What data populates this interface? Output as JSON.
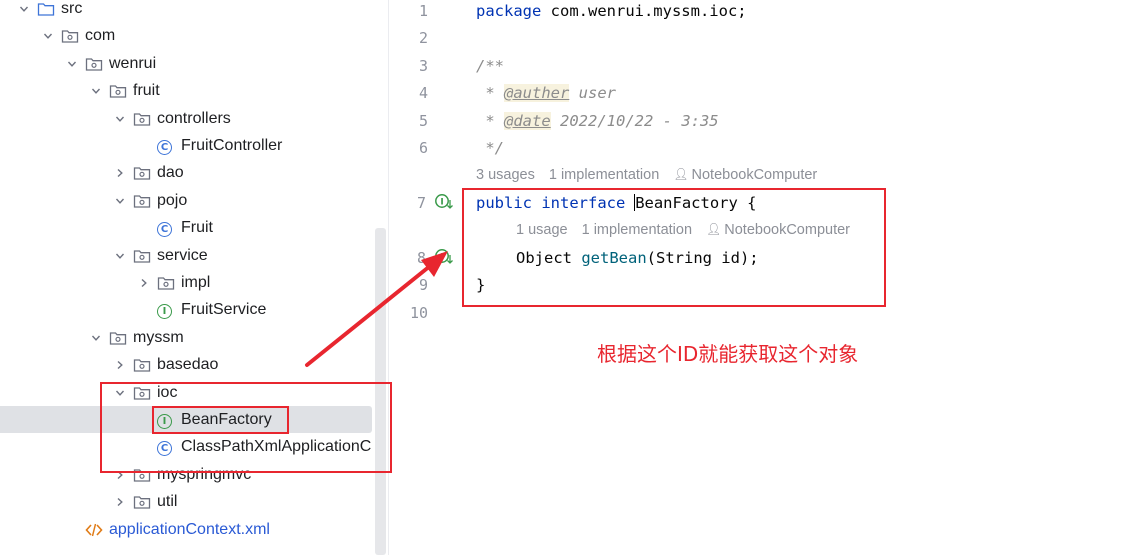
{
  "tree": {
    "items": [
      {
        "label": "src",
        "kind": "folder-src",
        "chevron": "down"
      },
      {
        "label": "com",
        "kind": "package",
        "chevron": "down"
      },
      {
        "label": "wenrui",
        "kind": "package",
        "chevron": "down"
      },
      {
        "label": "fruit",
        "kind": "package",
        "chevron": "down"
      },
      {
        "label": "controllers",
        "kind": "package",
        "chevron": "down"
      },
      {
        "label": "FruitController",
        "kind": "class"
      },
      {
        "label": "dao",
        "kind": "package",
        "chevron": "right"
      },
      {
        "label": "pojo",
        "kind": "package",
        "chevron": "down"
      },
      {
        "label": "Fruit",
        "kind": "class"
      },
      {
        "label": "service",
        "kind": "package",
        "chevron": "down"
      },
      {
        "label": "impl",
        "kind": "package",
        "chevron": "right"
      },
      {
        "label": "FruitService",
        "kind": "interface"
      },
      {
        "label": "myssm",
        "kind": "package",
        "chevron": "down"
      },
      {
        "label": "basedao",
        "kind": "package",
        "chevron": "right"
      },
      {
        "label": "ioc",
        "kind": "package",
        "chevron": "down"
      },
      {
        "label": "BeanFactory",
        "kind": "interface",
        "selected": true
      },
      {
        "label": "ClassPathXmlApplicationC",
        "kind": "class"
      },
      {
        "label": "myspringmvc",
        "kind": "package",
        "chevron": "right"
      },
      {
        "label": "util",
        "kind": "package",
        "chevron": "right"
      },
      {
        "label": "applicationContext.xml",
        "kind": "xml"
      }
    ]
  },
  "editor": {
    "line_numbers": [
      "1",
      "2",
      "3",
      "4",
      "5",
      "6",
      "7",
      "8",
      "9",
      "10"
    ],
    "line1": {
      "kw": "package",
      "rest": " com.wenrui.myssm.ioc;"
    },
    "line3": "/**",
    "line4": {
      "star": " * ",
      "tag": "@auther",
      "text": " user"
    },
    "line5": {
      "star": " * ",
      "tag": "@date",
      "text": " 2022/10/22 - 3:35"
    },
    "line6": " */",
    "hint_interface": {
      "usages": "3 usages",
      "impl": "1 implementation",
      "author": "NotebookComputer"
    },
    "line7": {
      "kw1": "public",
      "kw2": "interface",
      "name": "BeanFactory",
      "brace": " {"
    },
    "hint_method": {
      "usages": "1 usage",
      "impl": "1 implementation",
      "author": "NotebookComputer"
    },
    "line8": {
      "type": "Object ",
      "fn": "getBean",
      "args": "(String id);"
    },
    "line9": "}"
  },
  "annotation": {
    "note": "根据这个ID就能获取这个对象",
    "color": "#e8262f"
  },
  "colors": {
    "keyword": "#0033b3",
    "comment": "#8c8c8c",
    "method": "#00627a",
    "selection": "#dfe1e5",
    "xml_link": "#2a5ad5"
  }
}
